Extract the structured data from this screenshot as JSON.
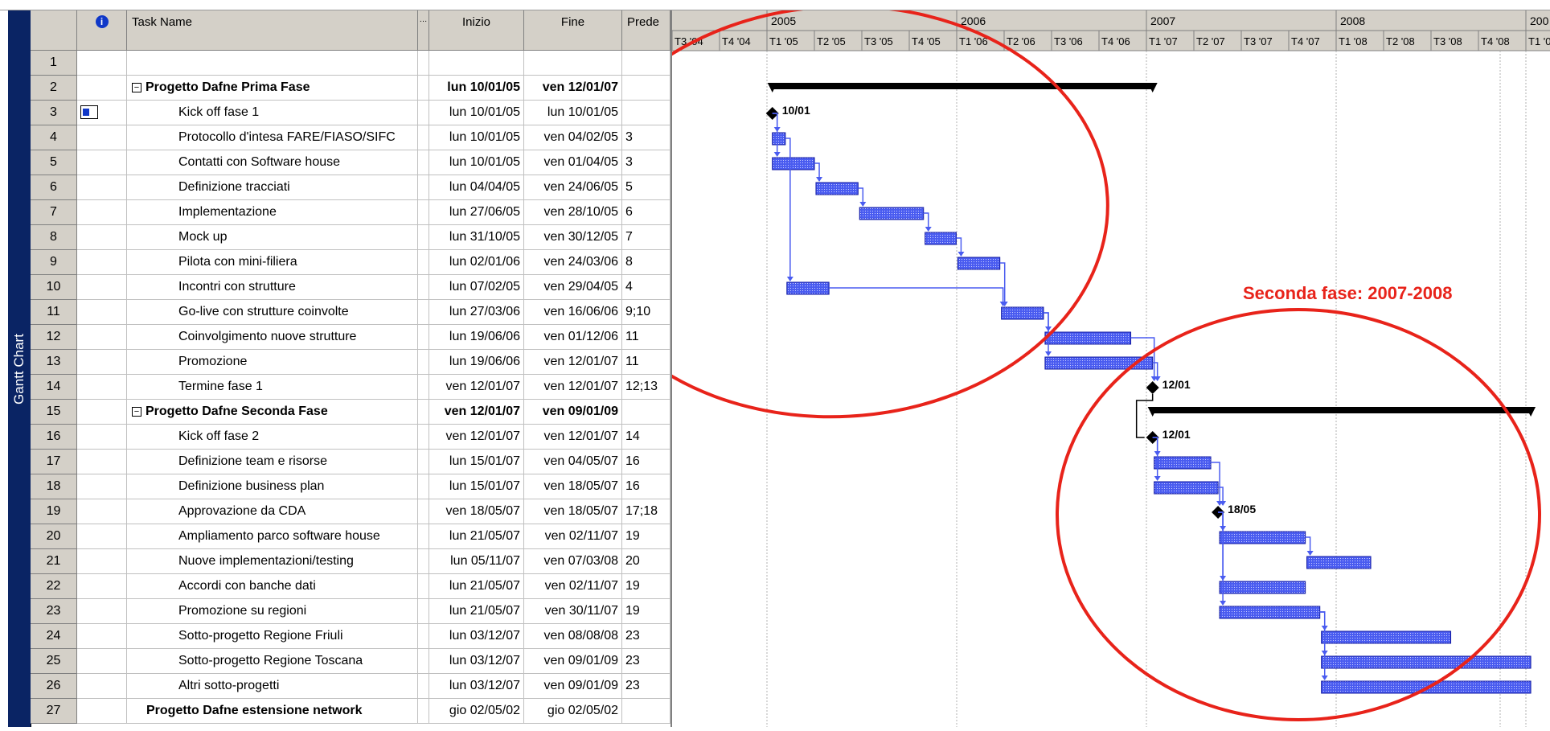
{
  "view": {
    "label": "Gantt Chart"
  },
  "columns": {
    "info": "i",
    "task_name": "Task Name",
    "duration": "…",
    "start": "Inizio",
    "finish": "Fine",
    "predecessors": "Prede"
  },
  "tasks": [
    {
      "id": "1",
      "name": "",
      "start": "",
      "finish": "",
      "pred": "",
      "level": 0,
      "summary": false
    },
    {
      "id": "2",
      "name": "Progetto Dafne Prima Fase",
      "start": "lun 10/01/05",
      "finish": "ven 12/01/07",
      "pred": "",
      "level": 0,
      "summary": true
    },
    {
      "id": "3",
      "name": "Kick off fase 1",
      "start": "lun 10/01/05",
      "finish": "lun 10/01/05",
      "pred": "",
      "level": 1,
      "summary": false
    },
    {
      "id": "4",
      "name": "Protocollo d'intesa FARE/FIASO/SIFC",
      "start": "lun 10/01/05",
      "finish": "ven 04/02/05",
      "pred": "3",
      "level": 1,
      "summary": false
    },
    {
      "id": "5",
      "name": "Contatti con Software house",
      "start": "lun 10/01/05",
      "finish": "ven 01/04/05",
      "pred": "3",
      "level": 1,
      "summary": false
    },
    {
      "id": "6",
      "name": "Definizione tracciati",
      "start": "lun 04/04/05",
      "finish": "ven 24/06/05",
      "pred": "5",
      "level": 1,
      "summary": false
    },
    {
      "id": "7",
      "name": "Implementazione",
      "start": "lun 27/06/05",
      "finish": "ven 28/10/05",
      "pred": "6",
      "level": 1,
      "summary": false
    },
    {
      "id": "8",
      "name": "Mock up",
      "start": "lun 31/10/05",
      "finish": "ven 30/12/05",
      "pred": "7",
      "level": 1,
      "summary": false
    },
    {
      "id": "9",
      "name": "Pilota con mini-filiera",
      "start": "lun 02/01/06",
      "finish": "ven 24/03/06",
      "pred": "8",
      "level": 1,
      "summary": false
    },
    {
      "id": "10",
      "name": "Incontri con strutture",
      "start": "lun 07/02/05",
      "finish": "ven 29/04/05",
      "pred": "4",
      "level": 1,
      "summary": false
    },
    {
      "id": "11",
      "name": "Go-live con strutture coinvolte",
      "start": "lun 27/03/06",
      "finish": "ven 16/06/06",
      "pred": "9;10",
      "level": 1,
      "summary": false
    },
    {
      "id": "12",
      "name": "Coinvolgimento nuove strutture",
      "start": "lun 19/06/06",
      "finish": "ven 01/12/06",
      "pred": "11",
      "level": 1,
      "summary": false
    },
    {
      "id": "13",
      "name": "Promozione",
      "start": "lun 19/06/06",
      "finish": "ven 12/01/07",
      "pred": "11",
      "level": 1,
      "summary": false
    },
    {
      "id": "14",
      "name": "Termine fase 1",
      "start": "ven 12/01/07",
      "finish": "ven 12/01/07",
      "pred": "12;13",
      "level": 1,
      "summary": false
    },
    {
      "id": "15",
      "name": "Progetto Dafne Seconda Fase",
      "start": "ven 12/01/07",
      "finish": "ven 09/01/09",
      "pred": "",
      "level": 0,
      "summary": true
    },
    {
      "id": "16",
      "name": "Kick off fase 2",
      "start": "ven 12/01/07",
      "finish": "ven 12/01/07",
      "pred": "14",
      "level": 1,
      "summary": false
    },
    {
      "id": "17",
      "name": "Definizione team e risorse",
      "start": "lun 15/01/07",
      "finish": "ven 04/05/07",
      "pred": "16",
      "level": 1,
      "summary": false
    },
    {
      "id": "18",
      "name": "Definizione business plan",
      "start": "lun 15/01/07",
      "finish": "ven 18/05/07",
      "pred": "16",
      "level": 1,
      "summary": false
    },
    {
      "id": "19",
      "name": "Approvazione da CDA",
      "start": "ven 18/05/07",
      "finish": "ven 18/05/07",
      "pred": "17;18",
      "level": 1,
      "summary": false
    },
    {
      "id": "20",
      "name": "Ampliamento parco software house",
      "start": "lun 21/05/07",
      "finish": "ven 02/11/07",
      "pred": "19",
      "level": 1,
      "summary": false
    },
    {
      "id": "21",
      "name": "Nuove implementazioni/testing",
      "start": "lun 05/11/07",
      "finish": "ven 07/03/08",
      "pred": "20",
      "level": 1,
      "summary": false
    },
    {
      "id": "22",
      "name": "Accordi con banche dati",
      "start": "lun 21/05/07",
      "finish": "ven 02/11/07",
      "pred": "19",
      "level": 1,
      "summary": false
    },
    {
      "id": "23",
      "name": "Promozione su regioni",
      "start": "lun 21/05/07",
      "finish": "ven 30/11/07",
      "pred": "19",
      "level": 1,
      "summary": false
    },
    {
      "id": "24",
      "name": "Sotto-progetto Regione Friuli",
      "start": "lun 03/12/07",
      "finish": "ven 08/08/08",
      "pred": "23",
      "level": 1,
      "summary": false
    },
    {
      "id": "25",
      "name": "Sotto-progetto Regione Toscana",
      "start": "lun 03/12/07",
      "finish": "ven 09/01/09",
      "pred": "23",
      "level": 1,
      "summary": false
    },
    {
      "id": "26",
      "name": "Altri sotto-progetti",
      "start": "lun 03/12/07",
      "finish": "ven 09/01/09",
      "pred": "23",
      "level": 1,
      "summary": false
    },
    {
      "id": "27",
      "name": "Progetto Dafne estensione network",
      "start": "gio 02/05/02",
      "finish": "gio 02/05/02",
      "pred": "",
      "level": 0,
      "summary": false,
      "boldname": true
    }
  ],
  "timescale": {
    "years": [
      "2005",
      "2006",
      "2007",
      "2008",
      "200"
    ],
    "quarters": [
      "T3 '04",
      "T4 '04",
      "T1 '05",
      "T2 '05",
      "T3 '05",
      "T4 '05",
      "T1 '06",
      "T2 '06",
      "T3 '06",
      "T4 '06",
      "T1 '07",
      "T2 '07",
      "T3 '07",
      "T4 '07",
      "T1 '08",
      "T2 '08",
      "T3 '08",
      "T4 '08",
      "T1 '0"
    ]
  },
  "milestones": [
    {
      "row": 3,
      "label": "10/01"
    },
    {
      "row": 14,
      "label": "12/01"
    },
    {
      "row": 16,
      "label": "12/01"
    },
    {
      "row": 19,
      "label": "18/05"
    }
  ],
  "annotation": {
    "text": "Seconda fase: 2007-2008",
    "color": "#e8231a"
  },
  "colors": {
    "bar": "#4a5cf0",
    "summary": "#000000",
    "header": "#d4d0c8",
    "viewbar": "#0a2464",
    "ellipse": "#e8231a"
  }
}
